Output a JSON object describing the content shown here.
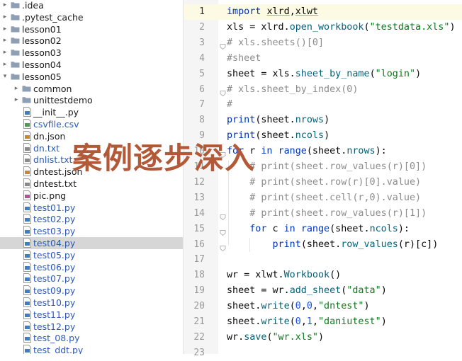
{
  "project_tree": [
    {
      "name": ".idea",
      "kind": "folder",
      "depth": 0,
      "expanded": false
    },
    {
      "name": ".pytest_cache",
      "kind": "folder",
      "depth": 0,
      "expanded": false
    },
    {
      "name": "lesson01",
      "kind": "folder",
      "depth": 0,
      "expanded": false
    },
    {
      "name": "lesson02",
      "kind": "folder",
      "depth": 0,
      "expanded": false
    },
    {
      "name": "lesson03",
      "kind": "folder",
      "depth": 0,
      "expanded": false
    },
    {
      "name": "lesson04",
      "kind": "folder",
      "depth": 0,
      "expanded": false
    },
    {
      "name": "lesson05",
      "kind": "folder",
      "depth": 0,
      "expanded": true
    },
    {
      "name": "common",
      "kind": "folder",
      "depth": 1,
      "expanded": false
    },
    {
      "name": "unittestdemo",
      "kind": "folder",
      "depth": 1,
      "expanded": false
    },
    {
      "name": "__init__.py",
      "kind": "py",
      "depth": 1
    },
    {
      "name": "csvfile.csv",
      "kind": "csv",
      "depth": 1,
      "vcs": "modified"
    },
    {
      "name": "dn.json",
      "kind": "json",
      "depth": 1
    },
    {
      "name": "dn.txt",
      "kind": "txt",
      "depth": 1,
      "vcs": "modified"
    },
    {
      "name": "dnlist.txt",
      "kind": "txt",
      "depth": 1,
      "vcs": "modified"
    },
    {
      "name": "dntest.json",
      "kind": "json",
      "depth": 1
    },
    {
      "name": "dntest.txt",
      "kind": "txt",
      "depth": 1
    },
    {
      "name": "pic.png",
      "kind": "png",
      "depth": 1
    },
    {
      "name": "test01.py",
      "kind": "py",
      "depth": 1,
      "vcs": "modified"
    },
    {
      "name": "test02.py",
      "kind": "py",
      "depth": 1,
      "vcs": "modified"
    },
    {
      "name": "test03.py",
      "kind": "py",
      "depth": 1,
      "vcs": "modified"
    },
    {
      "name": "test04.py",
      "kind": "py",
      "depth": 1,
      "vcs": "modified",
      "selected": true
    },
    {
      "name": "test05.py",
      "kind": "py",
      "depth": 1,
      "vcs": "modified"
    },
    {
      "name": "test06.py",
      "kind": "py",
      "depth": 1,
      "vcs": "modified"
    },
    {
      "name": "test07.py",
      "kind": "py",
      "depth": 1,
      "vcs": "modified"
    },
    {
      "name": "test09.py",
      "kind": "py",
      "depth": 1,
      "vcs": "modified"
    },
    {
      "name": "test10.py",
      "kind": "py",
      "depth": 1,
      "vcs": "modified"
    },
    {
      "name": "test11.py",
      "kind": "py",
      "depth": 1,
      "vcs": "modified"
    },
    {
      "name": "test12.py",
      "kind": "py",
      "depth": 1,
      "vcs": "modified"
    },
    {
      "name": "test_08.py",
      "kind": "py",
      "depth": 1,
      "vcs": "modified"
    },
    {
      "name": "test_ddt.py",
      "kind": "py",
      "depth": 1,
      "vcs": "modified"
    }
  ],
  "editor": {
    "active_line": 1,
    "lines": [
      {
        "n": "1",
        "fold": false,
        "tokens": [
          {
            "t": "import ",
            "c": "kw"
          },
          {
            "t": "xlrd",
            "c": "ul"
          },
          {
            "t": ","
          },
          {
            "t": "xlwt",
            "c": "ul"
          }
        ]
      },
      {
        "n": "2",
        "fold": false,
        "tokens": [
          {
            "t": "xls = xlrd."
          },
          {
            "t": "open_workbook",
            "c": "fn"
          },
          {
            "t": "("
          },
          {
            "t": "\"testdata.xls\"",
            "c": "str"
          },
          {
            "t": ")"
          }
        ]
      },
      {
        "n": "3",
        "fold": true,
        "tokens": [
          {
            "t": "# xls.sheets()[0]",
            "c": "cmt"
          }
        ]
      },
      {
        "n": "4",
        "fold": false,
        "tokens": [
          {
            "t": "#sheet",
            "c": "cmt"
          }
        ]
      },
      {
        "n": "5",
        "fold": false,
        "tokens": [
          {
            "t": "sheet = xls."
          },
          {
            "t": "sheet_by_name",
            "c": "fn"
          },
          {
            "t": "("
          },
          {
            "t": "\"login\"",
            "c": "str"
          },
          {
            "t": ")"
          }
        ]
      },
      {
        "n": "6",
        "fold": true,
        "tokens": [
          {
            "t": "# xls.sheet_by_index(0)",
            "c": "cmt"
          }
        ]
      },
      {
        "n": "7",
        "fold": false,
        "tokens": [
          {
            "t": "#",
            "c": "cmt"
          }
        ]
      },
      {
        "n": "8",
        "fold": false,
        "tokens": [
          {
            "t": "print",
            "c": "kw"
          },
          {
            "t": "(sheet."
          },
          {
            "t": "nrows",
            "c": "fn"
          },
          {
            "t": ")"
          }
        ]
      },
      {
        "n": "9",
        "fold": false,
        "tokens": [
          {
            "t": "print",
            "c": "kw"
          },
          {
            "t": "(sheet."
          },
          {
            "t": "ncols",
            "c": "fn"
          },
          {
            "t": ")"
          }
        ]
      },
      {
        "n": "10",
        "fold": true,
        "tokens": [
          {
            "t": "for ",
            "c": "kw"
          },
          {
            "t": "r "
          },
          {
            "t": "in ",
            "c": "kw"
          },
          {
            "t": "range",
            "c": "kw"
          },
          {
            "t": "(sheet."
          },
          {
            "t": "nrows",
            "c": "fn"
          },
          {
            "t": "):"
          }
        ]
      },
      {
        "n": "11",
        "fold": false,
        "tokens": [
          {
            "t": "    # print(sheet.row_values(r)[0])",
            "c": "cmt"
          }
        ]
      },
      {
        "n": "12",
        "fold": false,
        "tokens": [
          {
            "t": "    # print(sheet.row(r)[0].value)",
            "c": "cmt"
          }
        ]
      },
      {
        "n": "13",
        "fold": false,
        "tokens": [
          {
            "t": "    # print(sheet.cell(r,0).value)",
            "c": "cmt"
          }
        ]
      },
      {
        "n": "14",
        "fold": true,
        "tokens": [
          {
            "t": "    # print(sheet.row_values(r)[1])",
            "c": "cmt"
          }
        ]
      },
      {
        "n": "15",
        "fold": true,
        "tokens": [
          {
            "t": "    "
          },
          {
            "t": "for ",
            "c": "kw"
          },
          {
            "t": "c "
          },
          {
            "t": "in ",
            "c": "kw"
          },
          {
            "t": "range",
            "c": "kw"
          },
          {
            "t": "(sheet."
          },
          {
            "t": "ncols",
            "c": "fn"
          },
          {
            "t": "):"
          }
        ]
      },
      {
        "n": "16",
        "fold": true,
        "tokens": [
          {
            "t": "        "
          },
          {
            "t": "print",
            "c": "kw"
          },
          {
            "t": "(sheet."
          },
          {
            "t": "row_values",
            "c": "fn"
          },
          {
            "t": "(r)[c])"
          }
        ]
      },
      {
        "n": "17",
        "fold": false,
        "tokens": []
      },
      {
        "n": "18",
        "fold": false,
        "tokens": [
          {
            "t": "wr = xlwt."
          },
          {
            "t": "Workbook",
            "c": "fn"
          },
          {
            "t": "()"
          }
        ]
      },
      {
        "n": "19",
        "fold": false,
        "tokens": [
          {
            "t": "sheet = wr."
          },
          {
            "t": "add_sheet",
            "c": "fn"
          },
          {
            "t": "("
          },
          {
            "t": "\"data\"",
            "c": "str"
          },
          {
            "t": ")"
          }
        ]
      },
      {
        "n": "20",
        "fold": false,
        "tokens": [
          {
            "t": "sheet."
          },
          {
            "t": "write",
            "c": "fn"
          },
          {
            "t": "("
          },
          {
            "t": "0",
            "c": "num"
          },
          {
            "t": ","
          },
          {
            "t": "0",
            "c": "num"
          },
          {
            "t": ","
          },
          {
            "t": "\"dntest\"",
            "c": "str"
          },
          {
            "t": ")"
          }
        ]
      },
      {
        "n": "21",
        "fold": false,
        "tokens": [
          {
            "t": "sheet."
          },
          {
            "t": "write",
            "c": "fn"
          },
          {
            "t": "("
          },
          {
            "t": "0",
            "c": "num"
          },
          {
            "t": ","
          },
          {
            "t": "1",
            "c": "num"
          },
          {
            "t": ","
          },
          {
            "t": "\"daniutest\"",
            "c": "str"
          },
          {
            "t": ")"
          }
        ]
      },
      {
        "n": "22",
        "fold": false,
        "tokens": [
          {
            "t": "wr."
          },
          {
            "t": "save",
            "c": "fn"
          },
          {
            "t": "("
          },
          {
            "t": "\"wr.xls\"",
            "c": "str"
          },
          {
            "t": ")"
          }
        ]
      },
      {
        "n": "23",
        "fold": false,
        "tokens": []
      }
    ]
  },
  "watermark": {
    "text": "案例逐步深入",
    "color": "#b25a38"
  },
  "colors": {
    "keyword": "#0033b3",
    "function": "#00627a",
    "string": "#067d17",
    "number": "#1750eb",
    "comment": "#8c8c8c",
    "vcs_modified": "#2b58bc"
  }
}
